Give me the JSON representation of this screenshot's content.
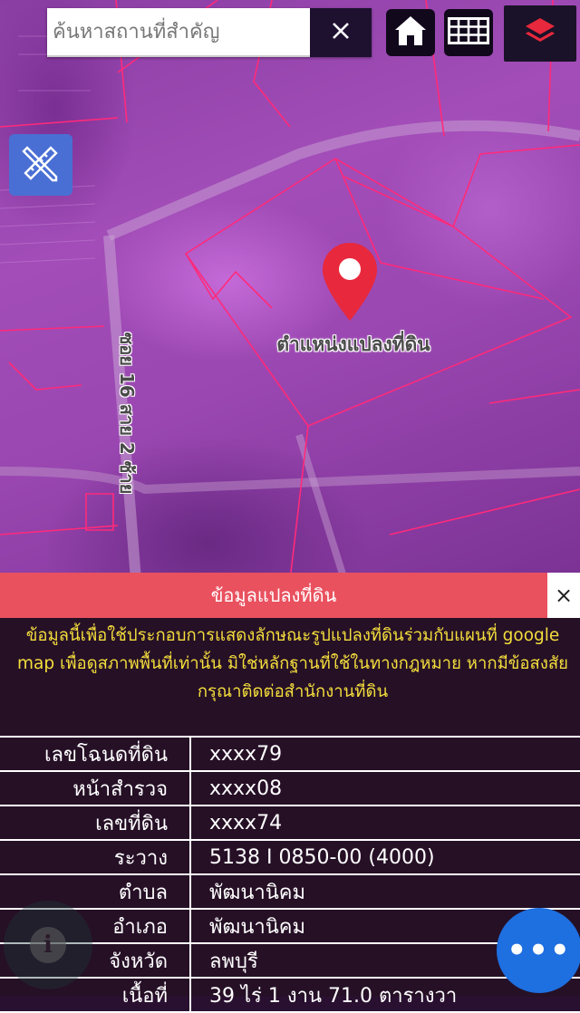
{
  "search": {
    "placeholder": "ค้นหาสถานที่สำคัญ",
    "clear_label": "✕"
  },
  "toolbar": {
    "home_icon": "home-icon",
    "grid_icon": "grid-icon",
    "layers_icon": "layers-icon",
    "measure_icon": "ruler-pencil-icon"
  },
  "map": {
    "pin_label": "ตำแหน่งแปลงที่ดิน",
    "road_label": "ซอย 16 สาย 2 ซ้าย",
    "pin_color": "#e8283c",
    "parcel_line_color": "#ff2a7a"
  },
  "panel": {
    "title": "ข้อมูลแปลงที่ดิน",
    "close_label": "×",
    "disclaimer": "ข้อมูลนี้เพื่อใช้ประกอบการแสดงลักษณะรูปแปลงที่ดินร่วมกับแผนที่ google map เพื่อดูสภาพพื้นที่เท่านั้น มิใช่หลักฐานที่ใช้ในทางกฎหมาย หากมีข้อสงสัย กรุณาติดต่อสำนักงานที่ดิน",
    "rows": [
      {
        "key": "เลขโฉนดที่ดิน",
        "value": "xxxx79"
      },
      {
        "key": "หน้าสำรวจ",
        "value": "xxxx08"
      },
      {
        "key": "เลขที่ดิน",
        "value": "xxxx74"
      },
      {
        "key": "ระวาง",
        "value": "5138 I 0850-00 (4000)"
      },
      {
        "key": "ตำบล",
        "value": "พัฒนานิคม"
      },
      {
        "key": "อำเภอ",
        "value": "พัฒนานิคม"
      },
      {
        "key": "จังหวัด",
        "value": "ลพบุรี"
      },
      {
        "key": "เนื้อที่",
        "value": "39 ไร่ 1 งาน 71.0 ตารางวา"
      }
    ]
  },
  "fab": {
    "info_label": "i",
    "more_label": "•••"
  }
}
